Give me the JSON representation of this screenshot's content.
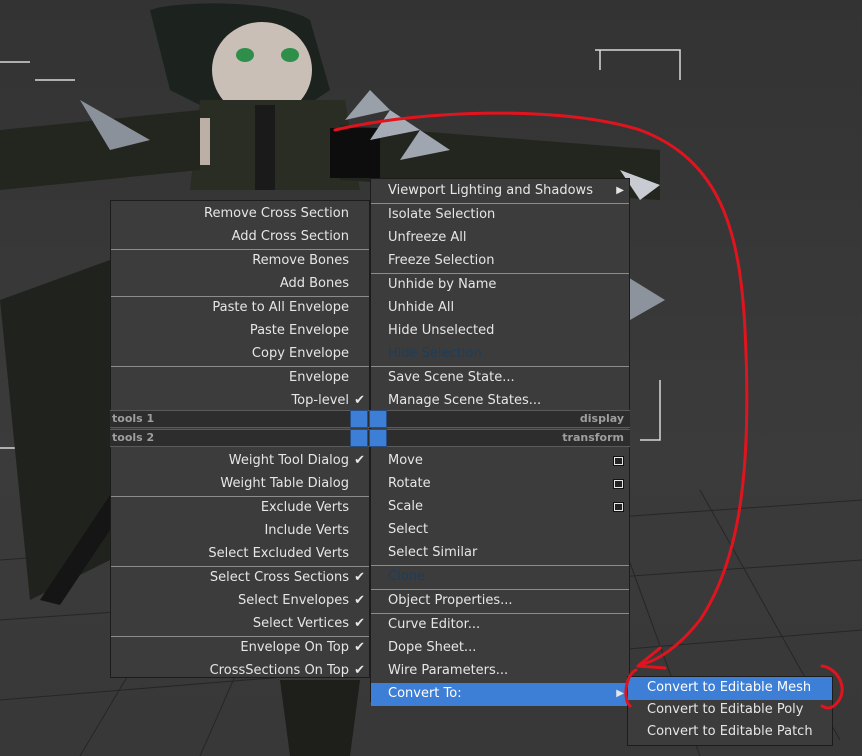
{
  "quad_left": {
    "groups": [
      [
        {
          "label": "Remove Cross Section",
          "checked": false
        },
        {
          "label": "Add Cross Section",
          "checked": false
        }
      ],
      [
        {
          "label": "Remove Bones",
          "checked": false
        },
        {
          "label": "Add Bones",
          "checked": false
        }
      ],
      [
        {
          "label": "Paste to All Envelope",
          "checked": false
        },
        {
          "label": "Paste Envelope",
          "checked": false
        },
        {
          "label": "Copy Envelope",
          "checked": false
        }
      ],
      [
        {
          "label": "Envelope",
          "checked": false
        },
        {
          "label": "Top-level",
          "checked": true
        }
      ],
      [
        {
          "label": "Weight Tool Dialog",
          "checked": true
        },
        {
          "label": "Weight Table Dialog",
          "checked": false
        }
      ],
      [
        {
          "label": "Exclude Verts",
          "checked": false
        },
        {
          "label": "Include Verts",
          "checked": false
        },
        {
          "label": "Select Excluded Verts",
          "checked": false
        }
      ],
      [
        {
          "label": "Select Cross Sections",
          "checked": true
        },
        {
          "label": "Select Envelopes",
          "checked": true
        },
        {
          "label": "Select Vertices",
          "checked": true
        }
      ],
      [
        {
          "label": "Envelope On Top",
          "checked": true
        },
        {
          "label": "CrossSections On Top",
          "checked": true
        }
      ]
    ]
  },
  "quad_right": {
    "top_groups": [
      [
        {
          "label": "Viewport Lighting and Shadows",
          "submenu": true
        }
      ],
      [
        {
          "label": "Isolate Selection"
        },
        {
          "label": "Unfreeze All"
        },
        {
          "label": "Freeze Selection"
        }
      ],
      [
        {
          "label": "Unhide by Name"
        },
        {
          "label": "Unhide All"
        },
        {
          "label": "Hide Unselected"
        },
        {
          "label": "Hide Selection",
          "disabled": true
        }
      ],
      [
        {
          "label": "Save Scene State..."
        },
        {
          "label": "Manage Scene States..."
        }
      ]
    ],
    "bottom_groups": [
      [
        {
          "label": "Move",
          "box": true
        },
        {
          "label": "Rotate",
          "box": true
        },
        {
          "label": "Scale",
          "box": true
        },
        {
          "label": "Select"
        },
        {
          "label": "Select Similar"
        }
      ],
      [
        {
          "label": "Clone",
          "disabled": true
        }
      ],
      [
        {
          "label": "Object Properties..."
        }
      ],
      [
        {
          "label": "Curve Editor..."
        },
        {
          "label": "Dope Sheet..."
        },
        {
          "label": "Wire Parameters..."
        },
        {
          "label": "Convert To:",
          "submenu": true,
          "highlighted": true
        }
      ]
    ]
  },
  "quad_headers": {
    "tools1": "tools 1",
    "tools2": "tools 2",
    "display": "display",
    "transform": "transform"
  },
  "convert_submenu": [
    {
      "label": "Convert to Editable Mesh",
      "highlighted": true
    },
    {
      "label": "Convert to Editable Poly"
    },
    {
      "label": "Convert to Editable Patch"
    }
  ],
  "colors": {
    "menu_bg": "#3c3c3c",
    "highlight": "#3d7fd6",
    "annotation": "#e0141e"
  }
}
